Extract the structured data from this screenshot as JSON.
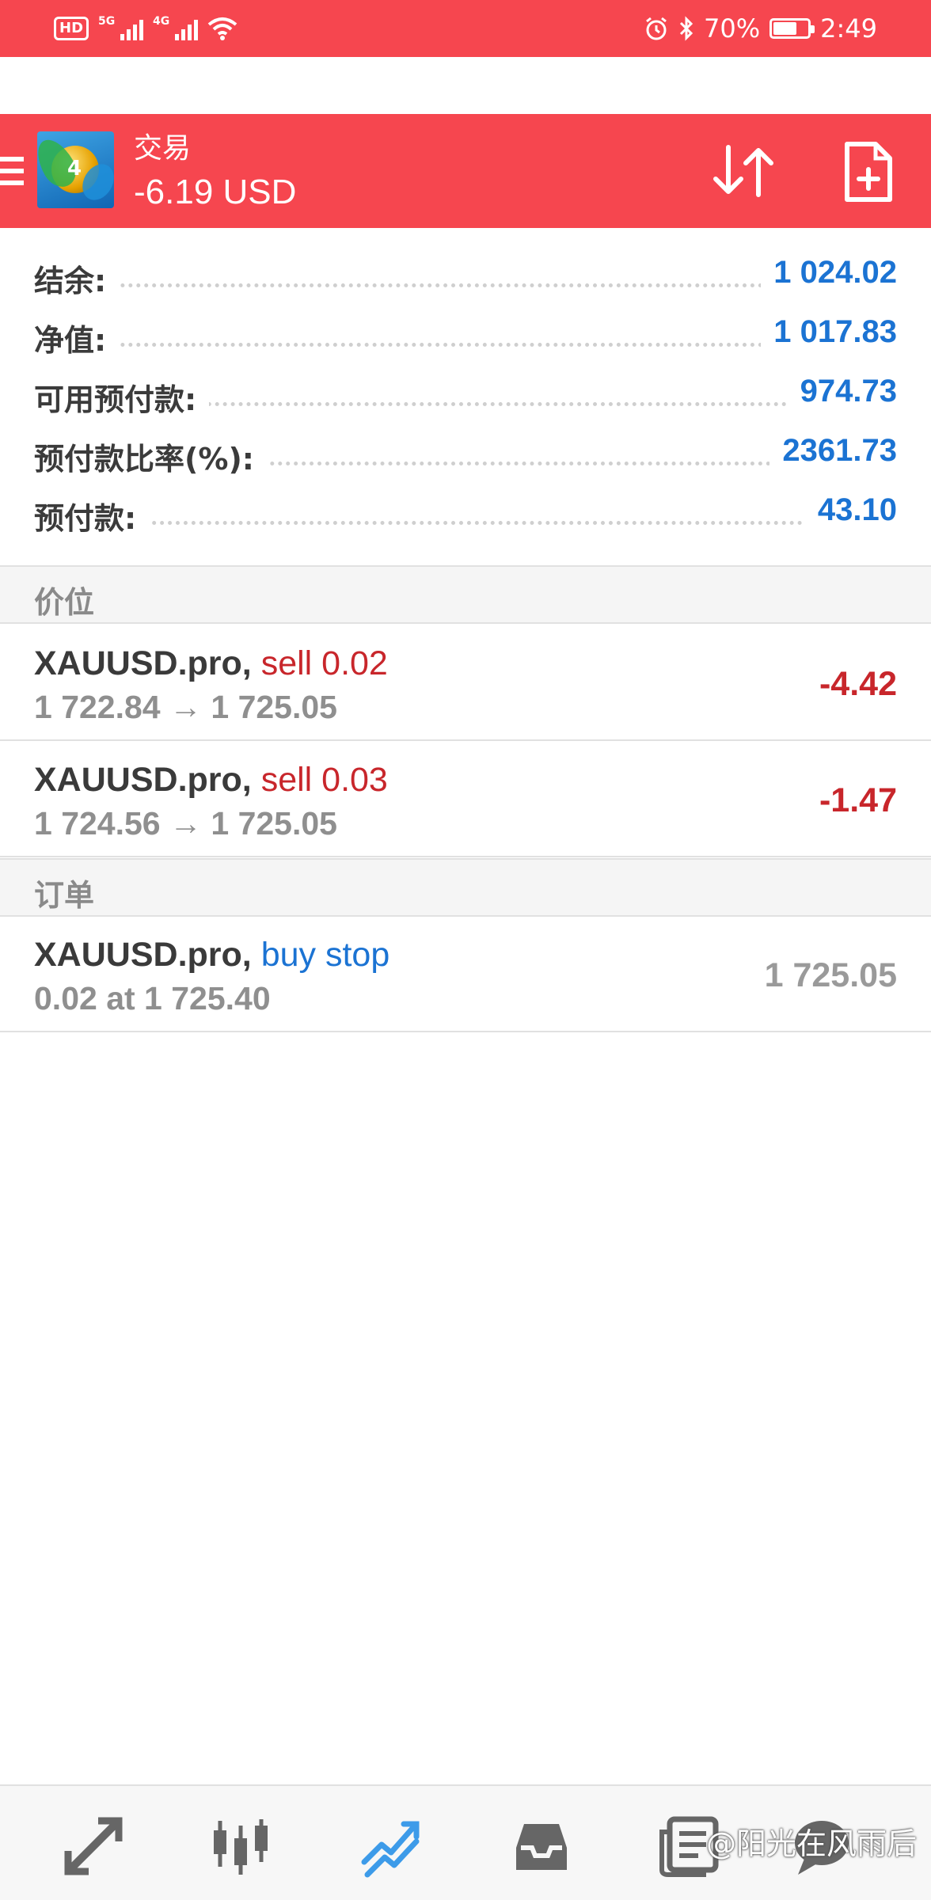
{
  "status_bar": {
    "hd": "HD",
    "sim1_tag": "5G",
    "sim2_tag": "4G",
    "battery": "70%",
    "battery_level": 0.7,
    "time": "2:49"
  },
  "app_bar": {
    "title": "交易",
    "subtitle": "-6.19 USD",
    "logo_badge": "4"
  },
  "summary": [
    {
      "label": "结余:",
      "value": "1 024.02"
    },
    {
      "label": "净值:",
      "value": "1 017.83"
    },
    {
      "label": "可用预付款:",
      "value": "974.73"
    },
    {
      "label": "预付款比率(%):",
      "value": "2361.73"
    },
    {
      "label": "预付款:",
      "value": "43.10"
    }
  ],
  "sections": {
    "positions": "价位",
    "orders": "订单"
  },
  "positions": [
    {
      "symbol": "XAUUSD.pro,",
      "side": "sell 0.02",
      "prices": "1 722.84 → 1 725.05",
      "profit": "-4.42"
    },
    {
      "symbol": "XAUUSD.pro,",
      "side": "sell 0.03",
      "prices": "1 724.56 → 1 725.05",
      "profit": "-1.47"
    }
  ],
  "orders": [
    {
      "symbol": "XAUUSD.pro,",
      "side": "buy stop",
      "detail": "0.02 at 1 725.40",
      "price": "1 725.05"
    }
  ],
  "colors": {
    "accent": "#f6464f",
    "value_blue": "#1b73d3",
    "loss_red": "#c8262b",
    "active_nav": "#3d9be9"
  },
  "nav": [
    {
      "icon": "quotes-arrows-icon",
      "active": false
    },
    {
      "icon": "chart-candles-icon",
      "active": false
    },
    {
      "icon": "trade-lines-icon",
      "active": true
    },
    {
      "icon": "history-inbox-icon",
      "active": false
    },
    {
      "icon": "news-icon",
      "active": false
    },
    {
      "icon": "chat-icon",
      "active": false
    }
  ],
  "watermark": "@阳光在风雨后"
}
